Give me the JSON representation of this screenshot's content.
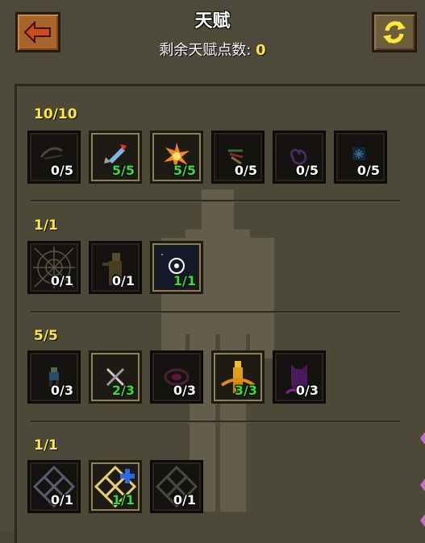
{
  "header": {
    "title": "天赋",
    "points_label": "剩余天赋点数:",
    "points_value": "0"
  },
  "tiers": [
    {
      "label": "10/10",
      "talents": [
        {
          "icon": "bow-icon",
          "count": "0/5",
          "full": false
        },
        {
          "icon": "winged-dart-icon",
          "count": "5/5",
          "full": true
        },
        {
          "icon": "explosion-icon",
          "count": "5/5",
          "full": true
        },
        {
          "icon": "arrows-icon",
          "count": "0/5",
          "full": false
        },
        {
          "icon": "vortex-icon",
          "count": "0/5",
          "full": false
        },
        {
          "icon": "frost-rune-icon",
          "count": "0/5",
          "full": false
        }
      ]
    },
    {
      "label": "1/1",
      "talents": [
        {
          "icon": "web-icon",
          "count": "0/1",
          "full": false
        },
        {
          "icon": "zombie-icon",
          "count": "0/1",
          "full": false
        },
        {
          "icon": "spirit-orb-icon",
          "count": "1/1",
          "full": true
        }
      ]
    },
    {
      "label": "5/5",
      "talents": [
        {
          "icon": "hero-icon",
          "count": "0/3",
          "full": false
        },
        {
          "icon": "crossed-swords-icon",
          "count": "2/3",
          "full": true
        },
        {
          "icon": "dark-swirl-icon",
          "count": "0/3",
          "full": false
        },
        {
          "icon": "golden-figure-icon",
          "count": "3/3",
          "full": true
        },
        {
          "icon": "shadow-demon-icon",
          "count": "0/3",
          "full": false
        }
      ]
    },
    {
      "label": "1/1",
      "talents": [
        {
          "icon": "gray-lattice-icon",
          "count": "0/1",
          "full": false
        },
        {
          "icon": "gold-lattice-plus-icon",
          "count": "1/1",
          "full": true
        },
        {
          "icon": "dark-lattice-icon",
          "count": "0/1",
          "full": false
        }
      ]
    }
  ],
  "colors": {
    "accent_yellow": "#ffe838",
    "count_full_green": "#33e133",
    "back_button": "#a8642a"
  }
}
